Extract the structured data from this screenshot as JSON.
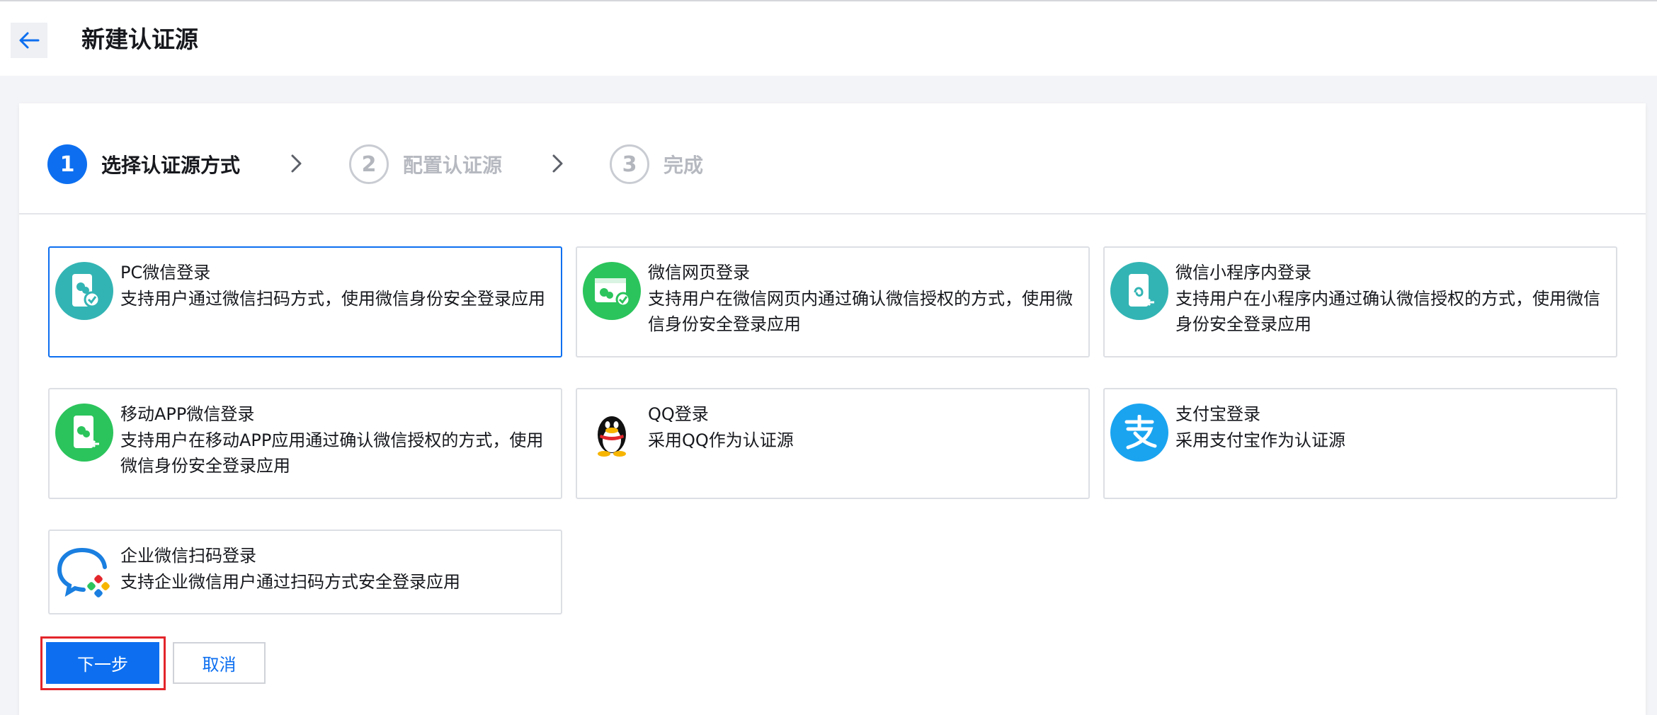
{
  "header": {
    "title": "新建认证源"
  },
  "steps": [
    {
      "number": "1",
      "label": "选择认证源方式"
    },
    {
      "number": "2",
      "label": "配置认证源"
    },
    {
      "number": "3",
      "label": "完成"
    }
  ],
  "options": [
    {
      "title": "PC微信登录",
      "desc": "支持用户通过微信扫码方式，使用微信身份安全登录应用",
      "icon": "pc-wechat-icon"
    },
    {
      "title": "微信网页登录",
      "desc": "支持用户在微信网页内通过确认微信授权的方式，使用微信身份安全登录应用",
      "icon": "wechat-web-icon"
    },
    {
      "title": "微信小程序内登录",
      "desc": "支持用户在小程序内通过确认微信授权的方式，使用微信身份安全登录应用",
      "icon": "wechat-miniprogram-icon"
    },
    {
      "title": "移动APP微信登录",
      "desc": "支持用户在移动APP应用通过确认微信授权的方式，使用微信身份安全登录应用",
      "icon": "mobile-app-wechat-icon"
    },
    {
      "title": "QQ登录",
      "desc": "采用QQ作为认证源",
      "icon": "qq-penguin-icon"
    },
    {
      "title": "支付宝登录",
      "desc": "采用支付宝作为认证源",
      "icon": "alipay-icon"
    },
    {
      "title": "企业微信扫码登录",
      "desc": "支持企业微信用户通过扫码方式安全登录应用",
      "icon": "wecom-icon"
    }
  ],
  "actions": {
    "next_label": "下一步",
    "cancel_label": "取消"
  },
  "colors": {
    "primary": "#0d6ff0",
    "wechat_green": "#2bc45c",
    "teal": "#33b4b4",
    "alipay_blue": "#1aa4f0",
    "highlight_red": "#e3262b"
  }
}
